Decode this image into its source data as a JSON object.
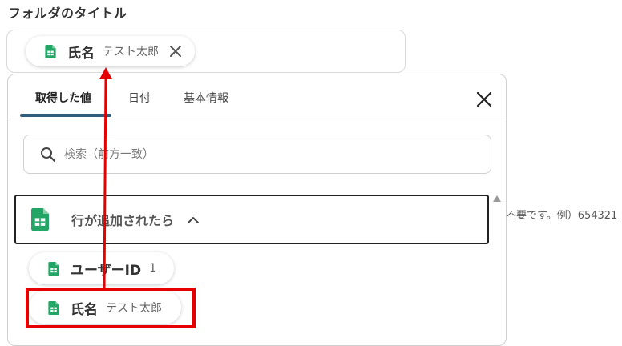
{
  "folder": {
    "label": "フォルダのタイトル",
    "chip": {
      "label": "氏名",
      "value": "テスト太郎",
      "icon": "google-sheets-icon",
      "close_icon": "close-icon"
    }
  },
  "panel": {
    "tabs": [
      {
        "label": "取得した値",
        "active": true
      },
      {
        "label": "日付",
        "active": false
      },
      {
        "label": "基本情報",
        "active": false
      }
    ],
    "search": {
      "placeholder": "検索（前方一致）",
      "value": ""
    },
    "trigger": {
      "label": "行が追加されたら",
      "expanded": true,
      "icon": "google-sheets-icon"
    },
    "items": [
      {
        "label": "ユーザーID",
        "value": "1"
      },
      {
        "label": "氏名",
        "value": "テスト太郎"
      }
    ]
  },
  "side_hint": "不要です。例）654321",
  "colors": {
    "accent_underline": "#2f5d7c",
    "annotation_red": "#e60000",
    "sheets_green": "#23a566"
  }
}
